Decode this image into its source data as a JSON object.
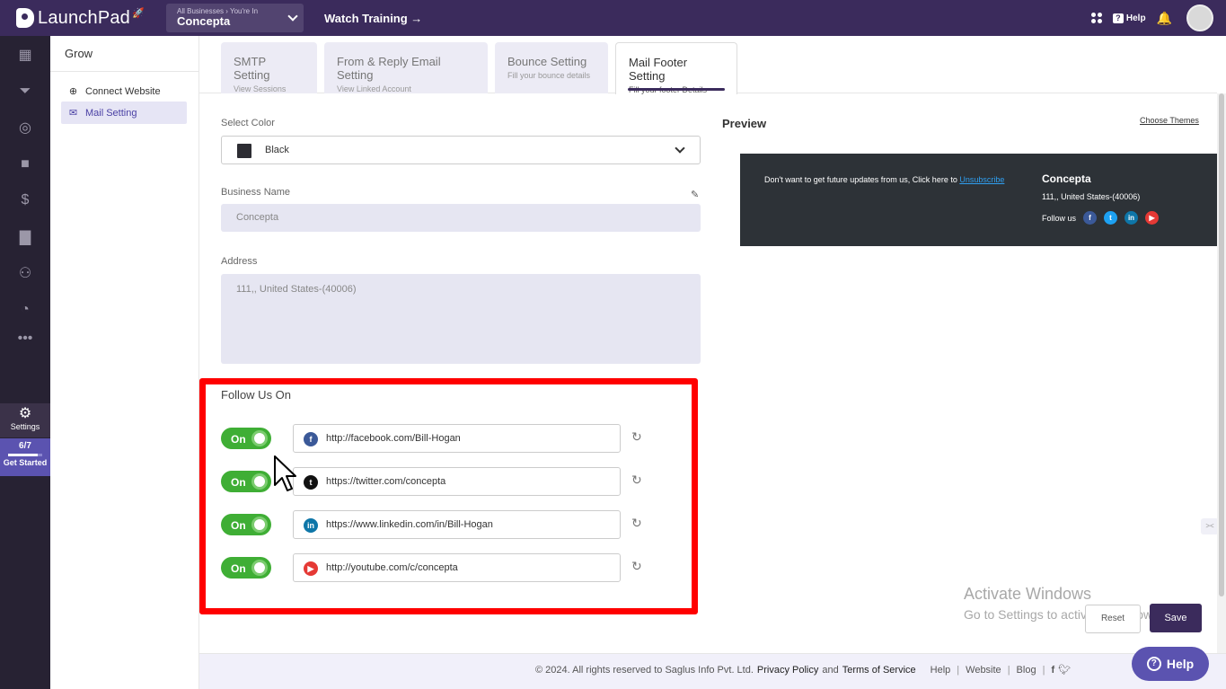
{
  "app": {
    "logo_text": "LaunchPad",
    "business_switcher": {
      "caption": "All Businesses › You're In",
      "name": "Concepta"
    },
    "watch_training": "Watch Training →",
    "help_label": "Help"
  },
  "rail": {
    "settings_label": "Settings",
    "progress_text": "6/7",
    "progress_fraction": 0.857,
    "get_started": "Get Started"
  },
  "subnav": {
    "title": "Grow",
    "items": [
      {
        "label": "Connect Website",
        "icon": "globe-icon"
      },
      {
        "label": "Mail Setting",
        "icon": "mail-icon"
      }
    ]
  },
  "tabs": [
    {
      "title": "SMTP Setting",
      "subtitle": "View Sessions"
    },
    {
      "title": "From & Reply Email Setting",
      "subtitle": "View Linked Account"
    },
    {
      "title": "Bounce Setting",
      "subtitle": "Fill your bounce details"
    },
    {
      "title": "Mail Footer Setting",
      "subtitle": "Fill your footer Details"
    }
  ],
  "form": {
    "color_label": "Select Color",
    "color_value": "Black",
    "color_swatch": "#2d2d33",
    "business_name_label": "Business Name",
    "business_name_value": "Concepta",
    "address_label": "Address",
    "address_value": "111,, United States-(40006)",
    "follow_title": "Follow Us On",
    "social": [
      {
        "network": "facebook",
        "toggle": "On",
        "url": "http://facebook.com/Bill-Hogan",
        "icon_color": "#3b5998",
        "glyph": "f"
      },
      {
        "network": "twitter",
        "toggle": "On",
        "url": "https://twitter.com/concepta",
        "icon_color": "#111111",
        "glyph": "t"
      },
      {
        "network": "linkedin",
        "toggle": "On",
        "url": "https://www.linkedin.com/in/Bill-Hogan",
        "icon_color": "#0e76a8",
        "glyph": "in"
      },
      {
        "network": "youtube",
        "toggle": "On",
        "url": "http://youtube.com/c/concepta",
        "icon_color": "#e53935",
        "glyph": "▶"
      }
    ]
  },
  "preview": {
    "title": "Preview",
    "choose_themes": "Choose Themes",
    "message": "Don't want to get future updates from us, Click here to",
    "unsubscribe": "Unsubscribe",
    "business_name": "Concepta",
    "address": "111,, United States-(40006)",
    "follow_label": "Follow us"
  },
  "actions": {
    "reset": "Reset",
    "save": "Save"
  },
  "watermark": {
    "line1": "Activate Windows",
    "line2": "Go to Settings to activate Windows."
  },
  "footer": {
    "copyright": "©  2024. All rights reserved to Saglus Info Pvt. Ltd.",
    "privacy": "Privacy Policy",
    "and": "and",
    "terms": "Terms of Service",
    "links": [
      "Help",
      "Website",
      "Blog"
    ],
    "help_button": "Help"
  },
  "colors": {
    "brand": "#3b2b5c",
    "accent": "#5b53b0",
    "toggle_on": "#3fae35",
    "highlight": "#ff0000"
  }
}
